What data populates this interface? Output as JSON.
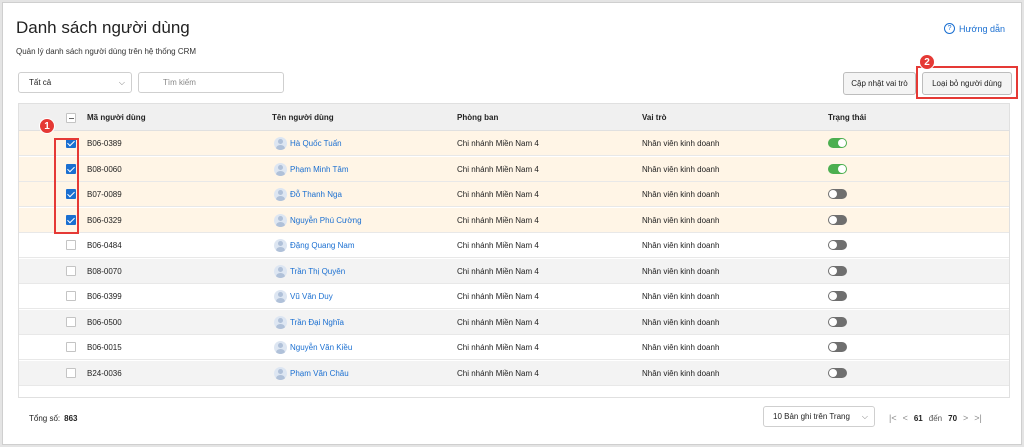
{
  "page": {
    "title": "Danh sách người dùng",
    "subtitle": "Quản lý danh sách người dùng trên hệ thống CRM",
    "help_label": "Hướng dẫn"
  },
  "toolbar": {
    "filter_value": "Tất cả",
    "search_placeholder": "Tìm kiếm",
    "update_role_label": "Cập nhật vai trò",
    "remove_user_label": "Loại bỏ người dùng"
  },
  "annotations": {
    "badge_1": "1",
    "badge_2": "2",
    "highlight_color": "#e53935"
  },
  "table": {
    "columns": [
      "Mã người dùng",
      "Tên người dùng",
      "Phòng ban",
      "Vai trò",
      "Trạng thái"
    ],
    "rows": [
      {
        "id": "B06-0389",
        "name": "Hà Quốc Tuấn",
        "dept": "Chi nhánh Miền Nam 4",
        "role": "Nhân viên kinh doanh",
        "checked": true,
        "active": true
      },
      {
        "id": "B08-0060",
        "name": "Phạm Minh Tâm",
        "dept": "Chi nhánh Miền Nam 4",
        "role": "Nhân viên kinh doanh",
        "checked": true,
        "active": true
      },
      {
        "id": "B07-0089",
        "name": "Đỗ Thanh Nga",
        "dept": "Chi nhánh Miền Nam 4",
        "role": "Nhân viên kinh doanh",
        "checked": true,
        "active": false
      },
      {
        "id": "B06-0329",
        "name": "Nguyễn Phú Cường",
        "dept": "Chi nhánh Miền Nam 4",
        "role": "Nhân viên kinh doanh",
        "checked": true,
        "active": false
      },
      {
        "id": "B06-0484",
        "name": "Đặng Quang Nam",
        "dept": "Chi nhánh Miền Nam 4",
        "role": "Nhân viên kinh doanh",
        "checked": false,
        "active": false
      },
      {
        "id": "B08-0070",
        "name": "Trần Thị Quyên",
        "dept": "Chi nhánh Miền Nam 4",
        "role": "Nhân viên kinh doanh",
        "checked": false,
        "active": false
      },
      {
        "id": "B06-0399",
        "name": "Vũ Văn Duy",
        "dept": "Chi nhánh Miền Nam 4",
        "role": "Nhân viên kinh doanh",
        "checked": false,
        "active": false
      },
      {
        "id": "B06-0500",
        "name": "Trần Đại Nghĩa",
        "dept": "Chi nhánh Miền Nam 4",
        "role": "Nhân viên kinh doanh",
        "checked": false,
        "active": false
      },
      {
        "id": "B06-0015",
        "name": "Nguyễn Văn Kiều",
        "dept": "Chi nhánh Miền Nam 4",
        "role": "Nhân viên kinh doanh",
        "checked": false,
        "active": false
      },
      {
        "id": "B24-0036",
        "name": "Phạm Văn Châu",
        "dept": "Chi nhánh Miền Nam 4",
        "role": "Nhân viên kinh doanh",
        "checked": false,
        "active": false
      }
    ]
  },
  "footer": {
    "total_label": "Tổng số:",
    "total_value": "863",
    "page_size": "10 Bản ghi trên Trang",
    "current_page": "61",
    "of_label": "đến",
    "total_pages": "70"
  },
  "icons": [
    "help-circle-icon",
    "chevron-down-icon",
    "search-icon",
    "avatar-icon",
    "first-page-icon",
    "prev-page-icon",
    "next-page-icon",
    "last-page-icon"
  ],
  "colors": {
    "accent": "#1a6fd1",
    "active_toggle": "#4caf50",
    "inactive_toggle": "#6f6f6f",
    "selected_row": "#fff5e6"
  }
}
